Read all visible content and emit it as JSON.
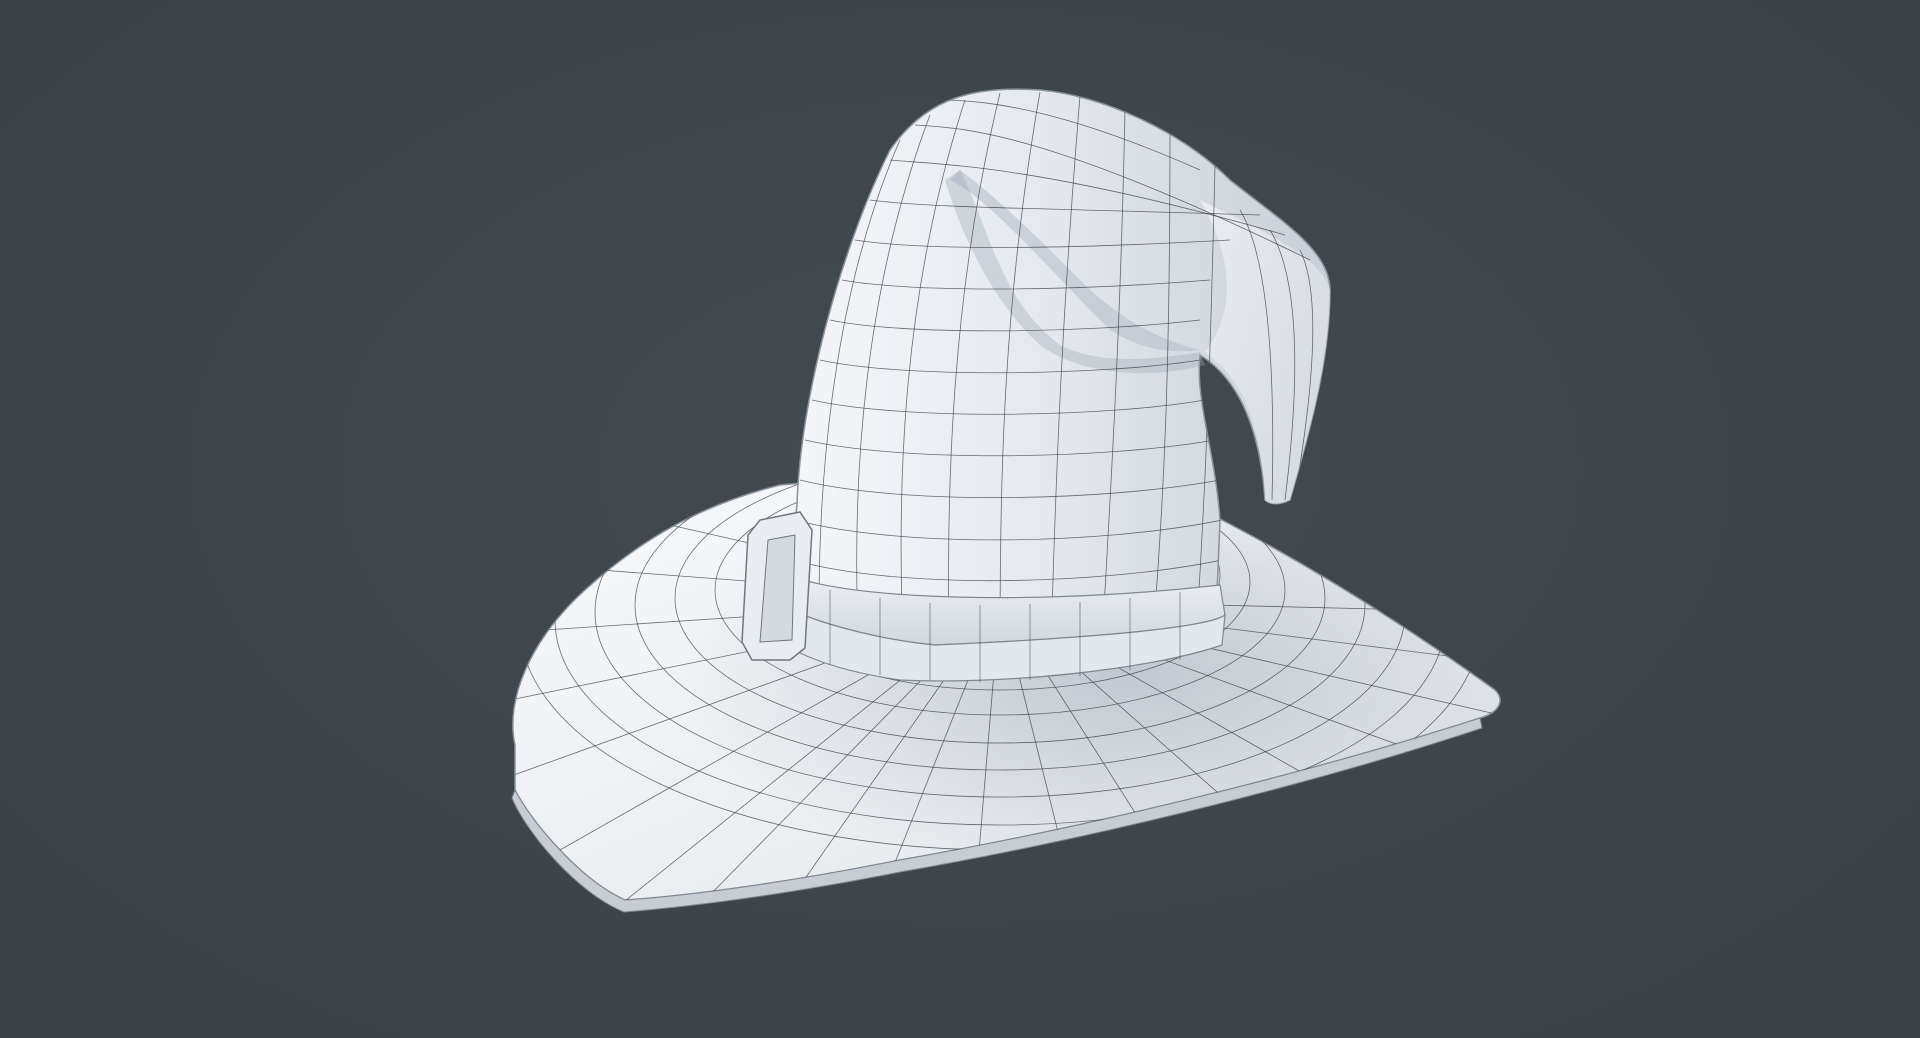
{
  "viewport": {
    "background_color": "#3e454a",
    "model": "witch-hat",
    "render_mode": "wireframe-over-shaded",
    "model_color": "#eef1f4",
    "wire_color": "#2a2d30"
  }
}
